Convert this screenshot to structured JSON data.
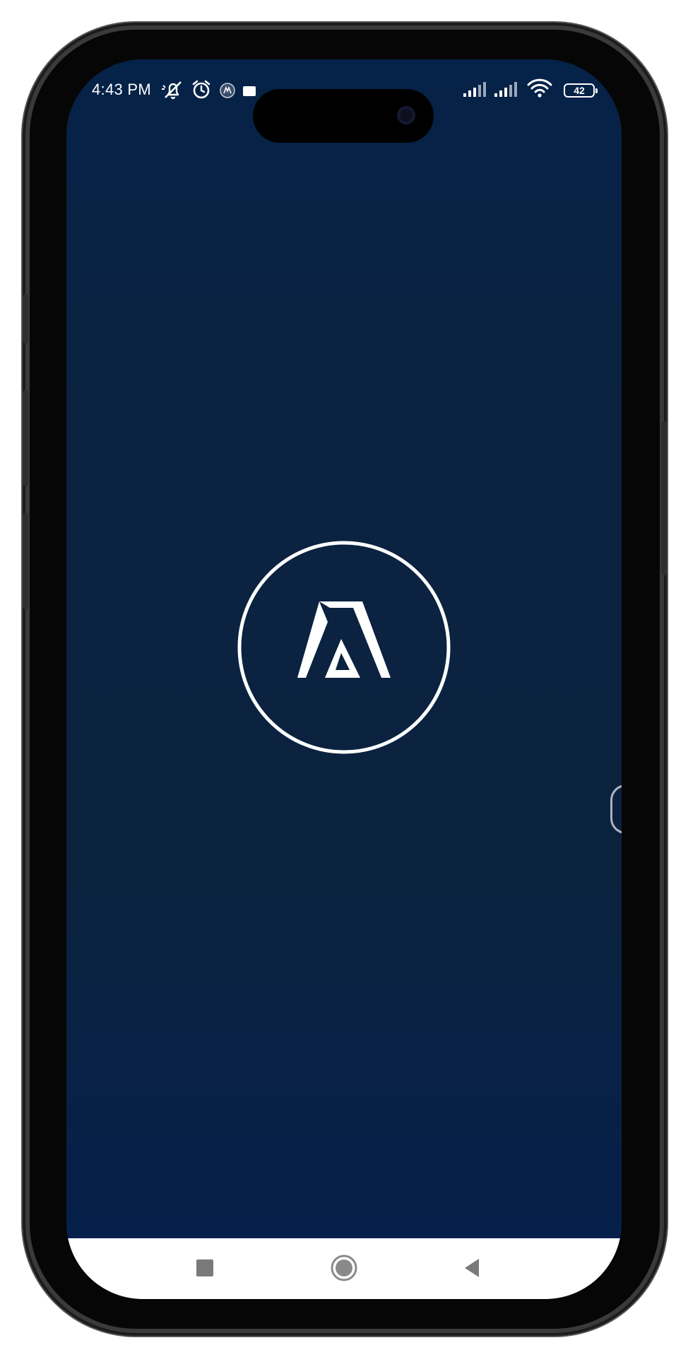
{
  "status_bar": {
    "time": "4:43 PM",
    "battery_level": "42",
    "icons": [
      "mute-icon",
      "alarm-icon",
      "app-notification-icon",
      "notification-square-icon",
      "signal-icon",
      "signal-icon",
      "wifi-icon",
      "battery-icon"
    ]
  },
  "splash": {
    "logo_icon": "brand-logo-icon",
    "background_color": "#0b2240",
    "logo_color": "#ffffff"
  },
  "nav_bar": {
    "buttons": [
      "recents-button",
      "home-button",
      "back-button"
    ]
  }
}
